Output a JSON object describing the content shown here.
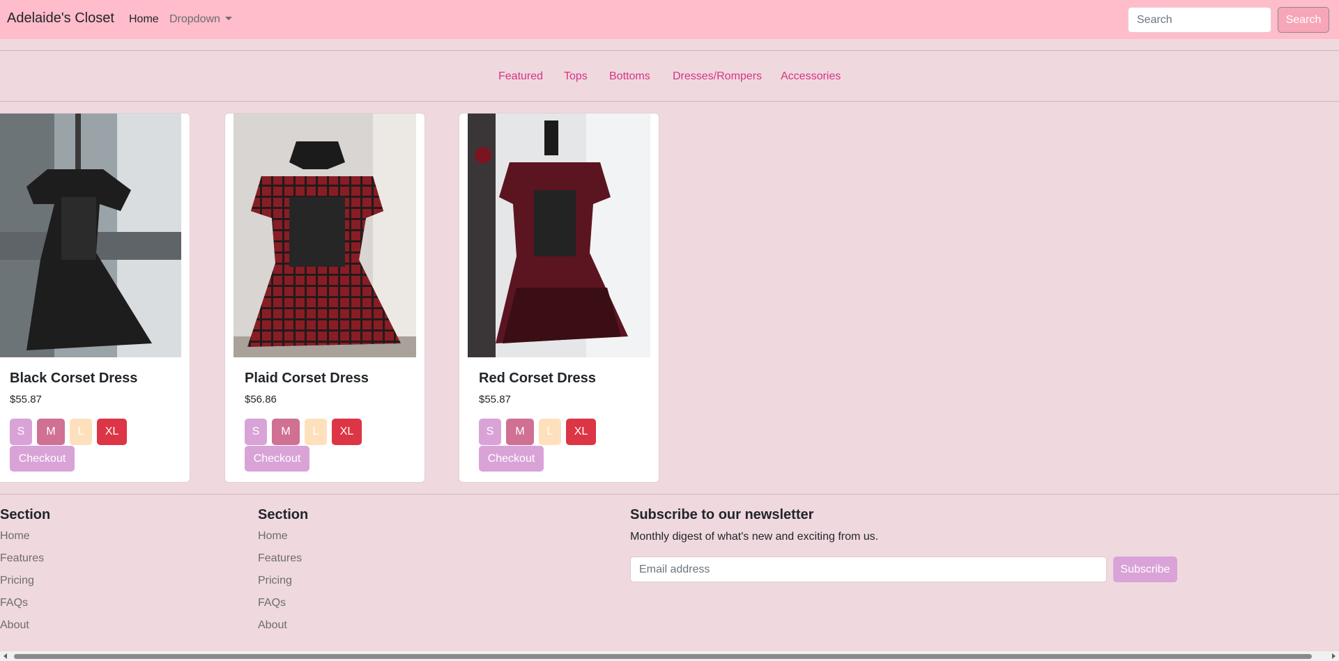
{
  "navbar": {
    "brand": "Adelaide's Closet",
    "home": "Home",
    "dropdown": "Dropdown",
    "search_placeholder": "Search",
    "search_button": "Search"
  },
  "categories": [
    "Featured",
    "Tops",
    "Bottoms",
    "Dresses/Rompers",
    "Accessories"
  ],
  "products": [
    {
      "name": "Black Corset Dress",
      "price": "$55.87",
      "image": "black-corset-dress-photo"
    },
    {
      "name": "Plaid Corset Dress",
      "price": "$56.86",
      "image": "plaid-corset-dress-photo"
    },
    {
      "name": "Red Corset Dress",
      "price": "$55.87",
      "image": "red-corset-dress-photo"
    }
  ],
  "sizes": [
    "S",
    "M",
    "L",
    "XL"
  ],
  "checkout_label": "Checkout",
  "footer": {
    "section1": {
      "title": "Section",
      "links": [
        "Home",
        "Features",
        "Pricing",
        "FAQs",
        "About"
      ]
    },
    "section2": {
      "title": "Section",
      "links": [
        "Home",
        "Features",
        "Pricing",
        "FAQs",
        "About"
      ]
    },
    "newsletter": {
      "title": "Subscribe to our newsletter",
      "subtitle": "Monthly digest of what's new and exciting from us.",
      "email_placeholder": "Email address",
      "subscribe_button": "Subscribe"
    }
  },
  "colors": {
    "navbar_bg": "#ffbccb",
    "page_bg": "#efd9de",
    "category_link": "#d63384",
    "size_s": "#d9a3d8",
    "size_m": "#d07093",
    "size_l": "#ffe0bd",
    "size_xl": "#dc3545",
    "checkout": "#d9a3d8"
  }
}
